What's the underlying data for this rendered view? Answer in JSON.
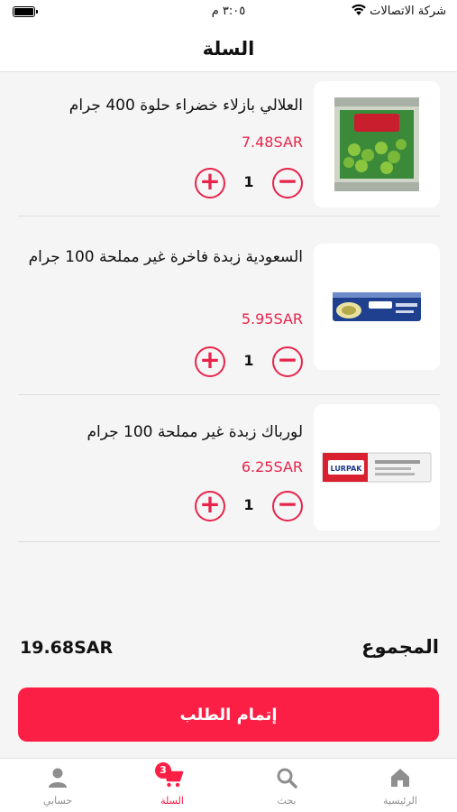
{
  "status_bar": {
    "carrier": "شركة الاتصالات",
    "time": "٣:٠٥ م"
  },
  "header": {
    "title": "السلة"
  },
  "cart": {
    "items": [
      {
        "name": "العلالي بازلاء خضراء حلوة 400 جرام",
        "price": "7.48SAR",
        "quantity": "1",
        "image_label": "بازلاء حلوة"
      },
      {
        "name": "السعودية زبدة فاخرة غير مملحة 100 جرام",
        "price": "5.95SAR",
        "quantity": "1",
        "image_label": "Saudia"
      },
      {
        "name": "لورباك زبدة غير مملحة 100 جرام",
        "price": "6.25SAR",
        "quantity": "1",
        "image_label": "LURPAK"
      }
    ]
  },
  "summary": {
    "total_label": "المجموع",
    "total_amount": "19.68SAR"
  },
  "checkout": {
    "label": "إتمام الطلب"
  },
  "tab_bar": {
    "home": "الرئيسية",
    "search": "بحث",
    "cart": "السلة",
    "account": "حسابي",
    "cart_badge": "3",
    "active": "cart"
  },
  "colors": {
    "accent": "#fb1f45",
    "price": "#e8244b",
    "inactive_tab": "#8e8e8e"
  }
}
